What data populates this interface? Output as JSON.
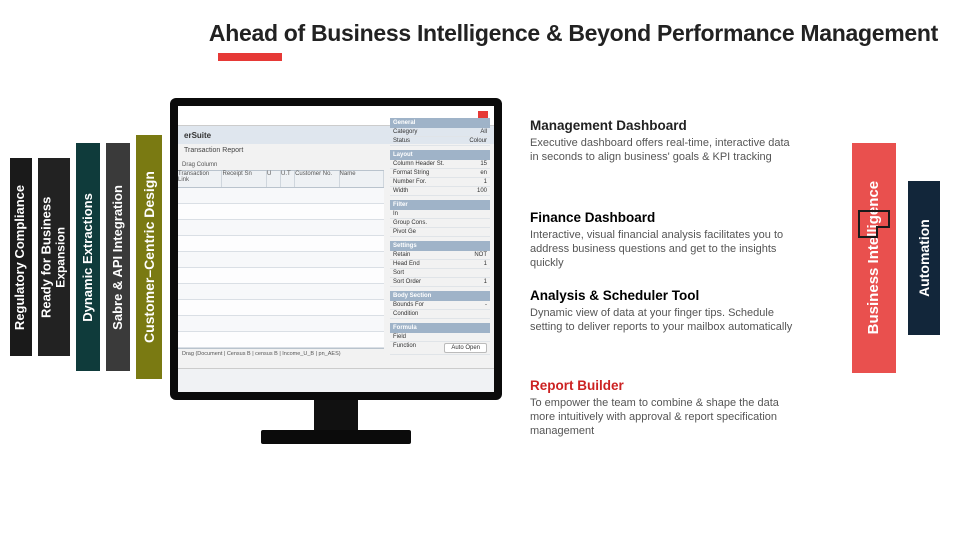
{
  "title": "Ahead of Business Intelligence & Beyond Performance Management",
  "left_tabs": {
    "regulatory": "Regulatory Compliance",
    "ready_line1": "Ready for Business",
    "ready_line2": "Expansion",
    "dynamic": "Dynamic Extractions",
    "sabre": "Sabre & API Integration",
    "customer": "Customer–Centric Design"
  },
  "screen": {
    "suite": "erSuite",
    "report_title": "Transaction Report",
    "grid_hint": "Drag Column",
    "cols": [
      "Transaction Link",
      "Receipt Sn",
      "U",
      "U.T",
      "Customer No.",
      "Name"
    ],
    "footer_hint": "Drag (Document | Census B | census B | Income_U_B | pn_AES)",
    "right_panel": {
      "general_h": "General",
      "general": [
        [
          "Category",
          "All"
        ],
        [
          "Status",
          "Colour"
        ]
      ],
      "layout_h": "Layout",
      "layout": [
        [
          "Column Header St.",
          "15"
        ],
        [
          "Format String",
          "en"
        ],
        [
          "Number For.",
          "1"
        ],
        [
          "Width",
          "100"
        ]
      ],
      "filter_h": "Filter",
      "filter": [
        [
          "In",
          ""
        ],
        [
          "Group Cons.",
          ""
        ],
        [
          "Pivot Ge",
          ""
        ]
      ],
      "settings_h": "Settings",
      "settings": [
        [
          "Retain",
          "NOT"
        ],
        [
          "Head End",
          "1"
        ],
        [
          "Sort",
          ""
        ],
        [
          "Sort Order",
          "1"
        ]
      ],
      "body_h": "Body Section",
      "body": [
        [
          "Bounds For",
          "-"
        ],
        [
          "Condition",
          ""
        ]
      ],
      "formula_h": "Formula",
      "formula": [
        [
          "Field",
          ""
        ],
        [
          "Function",
          "Auto Open"
        ]
      ]
    }
  },
  "right_text": {
    "r1_h": "Management Dashboard",
    "r1_p": "Executive dashboard offers real-time, interactive data in seconds to align business' goals & KPI tracking",
    "r2_h": "Finance Dashboard",
    "r2_p": "Interactive, visual financial analysis facilitates you to address business questions and get to the insights quickly",
    "r3_h": "Analysis & Scheduler Tool",
    "r3_p": "Dynamic view of data at your finger tips. Schedule setting to deliver reports to your mailbox automatically",
    "r4_h": "Report Builder",
    "r4_p": "To empower the team to combine & shape the data more intuitively with approval & report specification management"
  },
  "right_bars": {
    "bi": "Business Intelligence",
    "auto": "Automation"
  }
}
